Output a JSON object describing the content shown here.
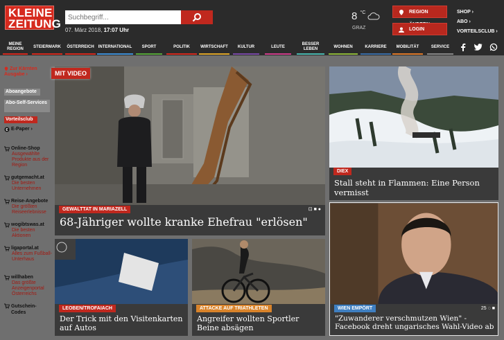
{
  "header": {
    "logo_line1": "KLEINE",
    "logo_line2": "ZEITUNG",
    "search_placeholder": "Suchbegriff...",
    "date": "07. März 2018,",
    "time": "17:07 Uhr",
    "temperature": "8",
    "temp_unit": "°C",
    "city": "GRAZ",
    "region_button": "REGION ÄNDERN",
    "login_button": "LOGIN",
    "links": [
      "SHOP",
      "ABO",
      "VORTEILSCLUB"
    ]
  },
  "nav": {
    "items": [
      {
        "label": "MEINE REGION",
        "color": "#d62a1e"
      },
      {
        "label": "STEIERMARK",
        "color": "#d62a1e"
      },
      {
        "label": "ÖSTERREICH",
        "color": "#d62a1e"
      },
      {
        "label": "INTERNATIONAL",
        "color": "#3f8fd6"
      },
      {
        "label": "SPORT",
        "color": "#57a83a"
      },
      {
        "label": "POLITIK",
        "color": "#d62a1e"
      },
      {
        "label": "WIRTSCHAFT",
        "color": "#e0a82a"
      },
      {
        "label": "KULTUR",
        "color": "#7a4aa8"
      },
      {
        "label": "LEUTE",
        "color": "#cf3d8c"
      },
      {
        "label": "BESSER LEBEN",
        "color": "#4ab8b0"
      },
      {
        "label": "WOHNEN",
        "color": "#8fb83a"
      },
      {
        "label": "KARRIERE",
        "color": "#3a6ea8"
      },
      {
        "label": "MOBILITÄT",
        "color": "#e07a2a"
      },
      {
        "label": "SERVICE",
        "color": "#888888"
      }
    ]
  },
  "sidebar": {
    "region_link": "Zur Kärnten Ausgabe",
    "aboangebote": "Aboangebote",
    "aboservices": "Abo-Self-Services",
    "vorteilsclub": "Vorteilsclub",
    "epaper": "E-Paper",
    "items": [
      {
        "title": "Online-Shop",
        "desc": "Ausgewählte Produkte aus der Region"
      },
      {
        "title": "gutgemacht.at",
        "desc": "Die besten Unternehmen"
      },
      {
        "title": "Reise-Angebote",
        "desc": "Die größten Reiseerlebnisse"
      },
      {
        "title": "wogibtswas.at",
        "desc": "Die besten Aktionen"
      },
      {
        "title": "ligaportal.at",
        "desc": "Alles zum Fußball-Unterhaus"
      },
      {
        "title": "willhaben",
        "desc": "Das größte Anzeigenportal Österreichs"
      },
      {
        "title": "Gutschein-Codes",
        "desc": ""
      }
    ]
  },
  "articles": {
    "main": {
      "badge": "MIT VIDEO",
      "tag": "GEWALTTAT IN MARIAZELL",
      "headline": "68-Jähriger wollte kranke Ehefrau \"erlösen\""
    },
    "right_top": {
      "tag": "DIEX",
      "headline": "Stall steht in Flammen: Eine Person vermisst"
    },
    "right_bottom": {
      "tag": "WIEN EMPÖRT",
      "headline": "\"Zuwanderer verschmutzen Wien\" - Facebook dreht ungarisches Wahl-Video ab",
      "comments": "25"
    },
    "bottom_left": {
      "tag": "LEOBEN/TROFAIACH",
      "headline": "Der Trick mit den Visitenkarten auf Autos"
    },
    "bottom_mid": {
      "tag": "ATTACKE AUF TRIATHLETEN",
      "headline": "Angreifer wollten Sportler Beine absägen"
    }
  },
  "colors": {
    "brand": "#d62a1e",
    "tag_red": "#c0281e",
    "tag_orange": "#d9832a"
  }
}
